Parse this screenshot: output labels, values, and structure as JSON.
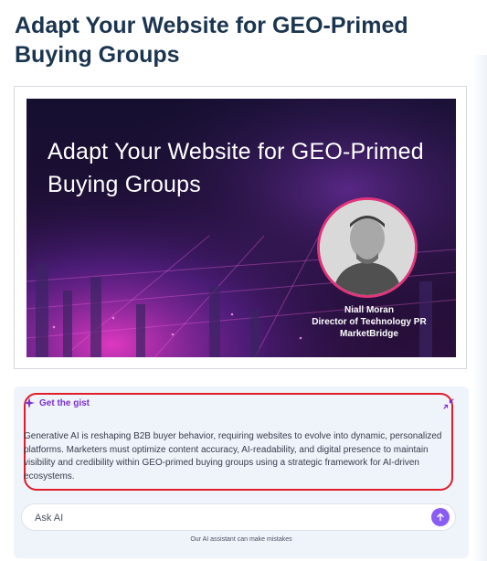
{
  "page": {
    "title": "Adapt Your Website for GEO-Primed Buying Groups"
  },
  "thumbnail": {
    "title": "Adapt Your Website for GEO-Primed Buying Groups",
    "speaker": {
      "name": "Niall Moran",
      "role": "Director of Technology PR",
      "company": "MarketBridge"
    }
  },
  "gist": {
    "label": "Get the gist",
    "summary": "Generative AI is reshaping B2B buyer behavior, requiring websites to evolve into dynamic, personalized platforms. Marketers must optimize content accuracy, AI-readability, and digital presence to maintain visibility and credibility within GEO-primed buying groups using a strategic framework for AI-driven ecosystems."
  },
  "ask": {
    "placeholder": "Ask AI",
    "disclaimer": "Our AI assistant can make mistakes"
  },
  "colors": {
    "title": "#1b3550",
    "accent_purple": "#8a5cf6",
    "highlight_red": "#e11d2a",
    "panel_bg": "#eff3fa"
  },
  "icons": {
    "gist": "sparkle-icon",
    "collapse": "collapse-arrows-icon",
    "send": "arrow-up-icon"
  }
}
